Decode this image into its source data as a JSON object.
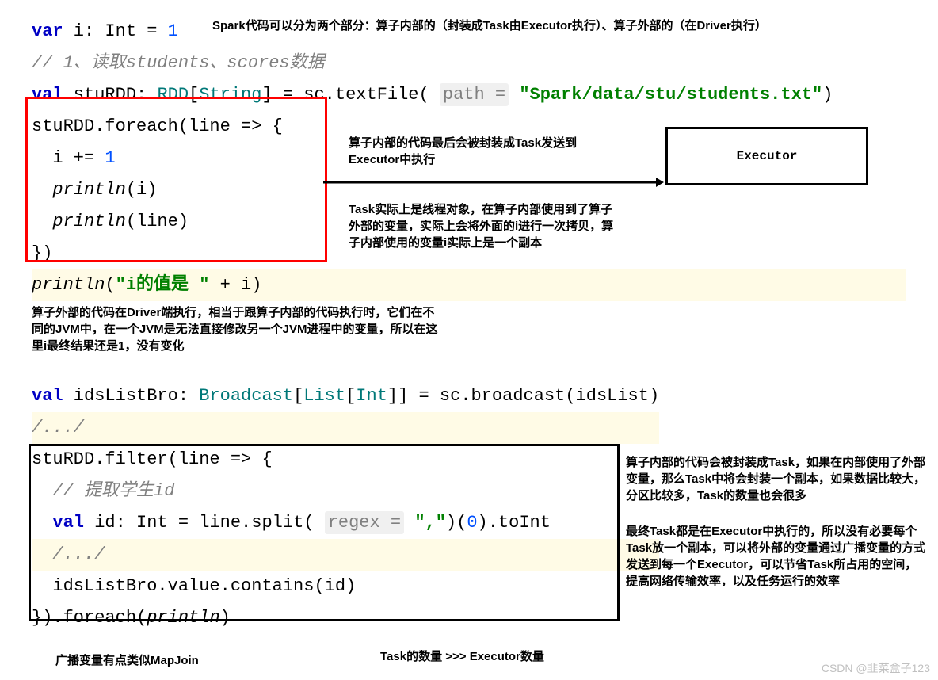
{
  "section1": {
    "line1_pre": "var",
    "line1_var": " i: ",
    "line1_type": "Int",
    "line1_eq": " = ",
    "line1_val": "1",
    "line2": "// 1、读取students、scores数据",
    "line3_val": "val",
    "line3_name": " stuRDD: ",
    "line3_rdd": "RDD",
    "line3_br": "[",
    "line3_str": "String",
    "line3_br2": "] = sc.textFile( ",
    "line3_hint": "path =",
    "line3_sp": " ",
    "line3_path": "\"Spark/data/stu/students.txt\"",
    "line3_end": ")",
    "line4": "stuRDD.foreach(line => {",
    "line5a": "  i += ",
    "line5b": "1",
    "line6a": "  ",
    "line6b": "println",
    "line6c": "(i)",
    "line7a": "  ",
    "line7b": "println",
    "line7c": "(line)",
    "line8": "})",
    "line9a": "println",
    "line9b": "(",
    "line9c": "\"i的值是 \"",
    "line9d": " + i)"
  },
  "annotations": {
    "top_right": "Spark代码可以分为两个部分：算子内部的（封装成Task由Executor执行）、算子外部的（在Driver执行）",
    "mid1": "算子内部的代码最后会被封装成Task发送到Executor中执行",
    "mid2": "Task实际上是线程对象，在算子内部使用到了算子外部的变量，实际上会将外面的i进行一次拷贝，算子内部使用的变量i实际上是一个副本",
    "executor": "Executor",
    "below1": "算子外部的代码在Driver端执行，相当于跟算子内部的代码执行时，它们在不同的JVM中，在一个JVM是无法直接修改另一个JVM进程中的变量，所以在这里i最终结果还是1，没有变化",
    "right2a": "算子内部的代码会被封装成Task，如果在内部使用了外部变量，那么Task中将会封装一个副本，如果数据比较大，分区比较多，Task的数量也会很多",
    "right2b": "最终Task都是在Executor中执行的，所以没有必要每个Task放一个副本，可以将外部的变量通过广播变量的方式发送到每一个Executor，可以节省Task所占用的空间，提高网络传输效率，以及任务运行的效率",
    "bottom1": "广播变量有点类似MapJoin",
    "bottom2": "Task的数量 >>> Executor数量"
  },
  "section2": {
    "l1_val": "val",
    "l1_name": " idsListBro: ",
    "l1_bc": "Broadcast",
    "l1_br": "[",
    "l1_list": "List",
    "l1_br2": "[",
    "l1_int": "Int",
    "l1_br3": "]] = sc.broadcast(idsList)",
    "l2": "/.../",
    "l3": "stuRDD.filter(line => {",
    "l4": "  // 提取学生id",
    "l5_pre": "  ",
    "l5_val": "val",
    "l5_a": " id: ",
    "l5_int": "Int",
    "l5_b": " = line.split( ",
    "l5_hint": "regex =",
    "l5_sp": " ",
    "l5_str": "\",\"",
    "l5_c": ")(",
    "l5_zero": "0",
    "l5_d": ").toInt",
    "l6": "  /.../",
    "l7": "  idsListBro.value.contains(id)",
    "l8": "}).foreach(",
    "l8b": "println",
    "l8c": ")"
  },
  "watermark": "CSDN @韭菜盒子123"
}
